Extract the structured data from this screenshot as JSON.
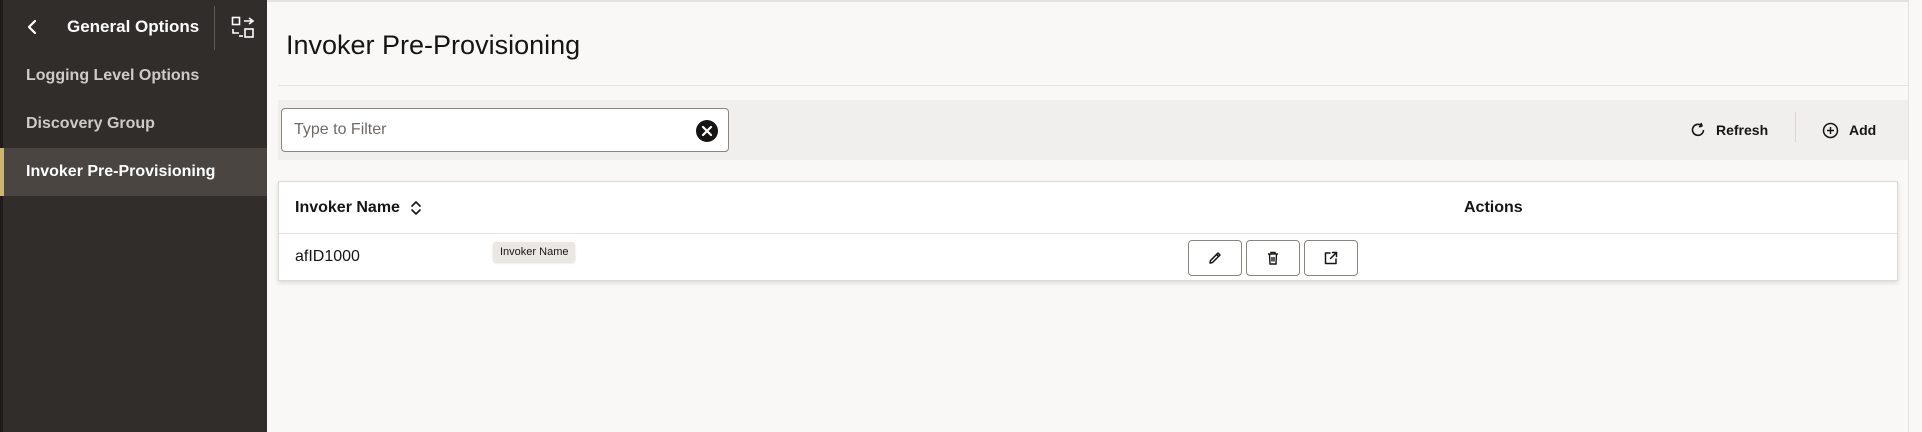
{
  "sidebar": {
    "title": "General Options",
    "back_icon": "chevron-left-icon",
    "toggle_icon": "collapse-panel-icon",
    "items": [
      {
        "label": "Logging Level Options",
        "active": false
      },
      {
        "label": "Discovery Group",
        "active": false
      },
      {
        "label": "Invoker Pre-Provisioning",
        "active": true
      }
    ]
  },
  "page": {
    "title": "Invoker Pre-Provisioning"
  },
  "toolbar": {
    "filter_placeholder": "Type to Filter",
    "filter_value": "",
    "refresh_label": "Refresh",
    "add_label": "Add"
  },
  "table": {
    "columns": [
      "Invoker Name",
      "Actions"
    ],
    "rows": [
      {
        "invoker_name": "afID1000",
        "actions": [
          "edit-icon",
          "delete-icon",
          "open-external-icon"
        ]
      }
    ],
    "tooltip": "Invoker Name"
  },
  "colors": {
    "sidebar_bg": "#312d2a",
    "sidebar_active_bg": "#4a4540",
    "active_accent": "#d3b26a",
    "page_bg": "#f9f8f6",
    "toolbar_bg": "#f1efed"
  }
}
